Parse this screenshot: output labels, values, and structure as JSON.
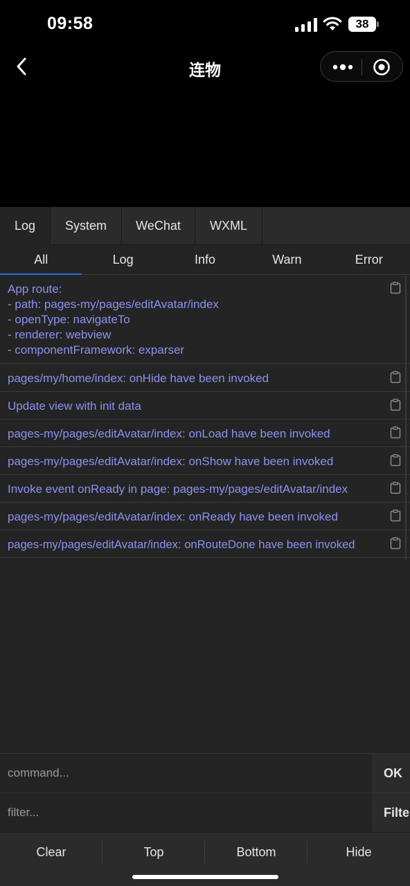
{
  "status_bar": {
    "time": "09:58",
    "battery": "38"
  },
  "nav": {
    "title": "连物"
  },
  "top_tabs": [
    {
      "label": "Log",
      "active": true
    },
    {
      "label": "System",
      "active": false
    },
    {
      "label": "WeChat",
      "active": false
    },
    {
      "label": "WXML",
      "active": false
    }
  ],
  "sub_tabs": [
    {
      "label": "All",
      "active": true
    },
    {
      "label": "Log",
      "active": false
    },
    {
      "label": "Info",
      "active": false
    },
    {
      "label": "Warn",
      "active": false
    },
    {
      "label": "Error",
      "active": false
    }
  ],
  "logs": [
    {
      "text": "App route:\n- path: pages-my/pages/editAvatar/index\n- openType: navigateTo\n- renderer: webview\n- componentFramework: exparser"
    },
    {
      "text": "pages/my/home/index: onHide have been invoked"
    },
    {
      "text": "Update view with init data"
    },
    {
      "text": "pages-my/pages/editAvatar/index: onLoad have been invoked"
    },
    {
      "text": "pages-my/pages/editAvatar/index: onShow have been invoked"
    },
    {
      "text": "Invoke event onReady in page: pages-my/pages/editAvatar/index"
    },
    {
      "text": "pages-my/pages/editAvatar/index: onReady have been invoked"
    },
    {
      "text": "pages-my/pages/editAvatar/index: onRouteDone have been invoked"
    }
  ],
  "command": {
    "placeholder": "command...",
    "button": "OK"
  },
  "filter": {
    "placeholder": "filter...",
    "button": "Filter"
  },
  "toolbar": {
    "clear": "Clear",
    "top": "Top",
    "bottom": "Bottom",
    "hide": "Hide"
  },
  "colors": {
    "log_text": "#8b92f0",
    "active_tab_underline": "#1c6fe0",
    "panel_bg": "#242424"
  }
}
